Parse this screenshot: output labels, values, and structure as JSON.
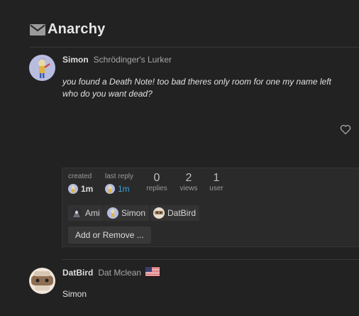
{
  "topic": {
    "title": "Anarchy",
    "icon": "envelope-icon"
  },
  "posts": [
    {
      "username": "Simon",
      "user_title": "Schrödinger's Lurker",
      "body": "you found a Death Note! too bad theres only room for one my name left who do you want dead?",
      "like_icon": "heart-icon"
    },
    {
      "username": "DatBird",
      "user_title": "Dat Mclean",
      "flag_icon": "us-flag-icon",
      "body": "Simon"
    }
  ],
  "topic_map": {
    "created_label": "created",
    "created_value": "1m",
    "last_reply_label": "last reply",
    "last_reply_value": "1m",
    "replies_count": "0",
    "replies_label": "replies",
    "views_count": "2",
    "views_label": "views",
    "users_count": "1",
    "users_label": "user",
    "participants": [
      "Ami",
      "Simon",
      "DatBird"
    ],
    "add_remove_label": "Add or Remove ..."
  },
  "colors": {
    "background": "#222222",
    "link_blue": "#3aa0d8",
    "separator": "#383838"
  }
}
